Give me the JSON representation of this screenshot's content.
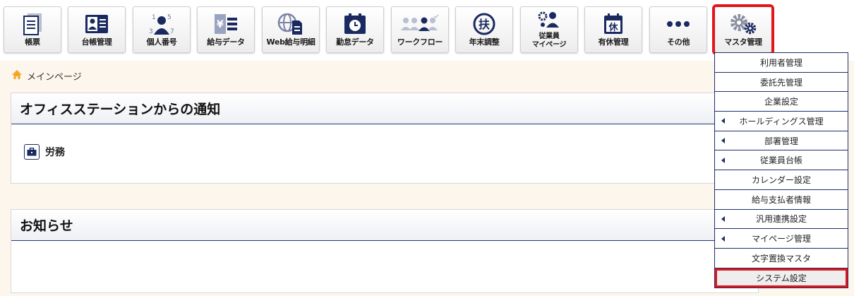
{
  "toolbar": {
    "items": [
      {
        "label": "帳票",
        "icon": "document-list-icon"
      },
      {
        "label": "台帳管理",
        "icon": "id-card-icon"
      },
      {
        "label": "個人番号",
        "icon": "person-number-icon"
      },
      {
        "label": "給与データ",
        "icon": "yen-list-icon"
      },
      {
        "label": "Web給与明細",
        "icon": "globe-document-icon"
      },
      {
        "label": "勤怠データ",
        "icon": "clock-calendar-icon"
      },
      {
        "label": "ワークフロー",
        "icon": "workflow-people-icon"
      },
      {
        "label": "年末調整",
        "icon": "fu-kanji-circle-icon"
      },
      {
        "label1": "従業員",
        "label2": "マイページ",
        "icon": "employee-gear-icon"
      },
      {
        "label": "有休管理",
        "icon": "calendar-kyu-icon"
      },
      {
        "label": "その他",
        "icon": "more-dots-icon"
      },
      {
        "label": "マスタ管理",
        "icon": "gears-icon"
      }
    ]
  },
  "breadcrumb": {
    "label": "メインページ",
    "icon": "home-icon"
  },
  "notice_panel": {
    "title": "オフィスステーションからの通知",
    "category_label": "労務",
    "category_icon": "briefcase-icon"
  },
  "news_panel": {
    "title": "お知らせ"
  },
  "master_menu": {
    "items": [
      {
        "label": "利用者管理",
        "submenu": false
      },
      {
        "label": "委託先管理",
        "submenu": false
      },
      {
        "label": "企業設定",
        "submenu": false
      },
      {
        "label": "ホールディングス管理",
        "submenu": true
      },
      {
        "label": "部署管理",
        "submenu": true
      },
      {
        "label": "従業員台帳",
        "submenu": true
      },
      {
        "label": "カレンダー設定",
        "submenu": false
      },
      {
        "label": "給与支払者情報",
        "submenu": false
      },
      {
        "label": "汎用連携設定",
        "submenu": true
      },
      {
        "label": "マイページ管理",
        "submenu": true
      },
      {
        "label": "文字置換マスタ",
        "submenu": false
      },
      {
        "label": "システム設定",
        "submenu": false
      }
    ]
  },
  "colors": {
    "navy": "#1a2a60",
    "highlight_red": "#e0161b",
    "page_bg": "#fdf6ec",
    "home_icon": "#f5a623"
  }
}
